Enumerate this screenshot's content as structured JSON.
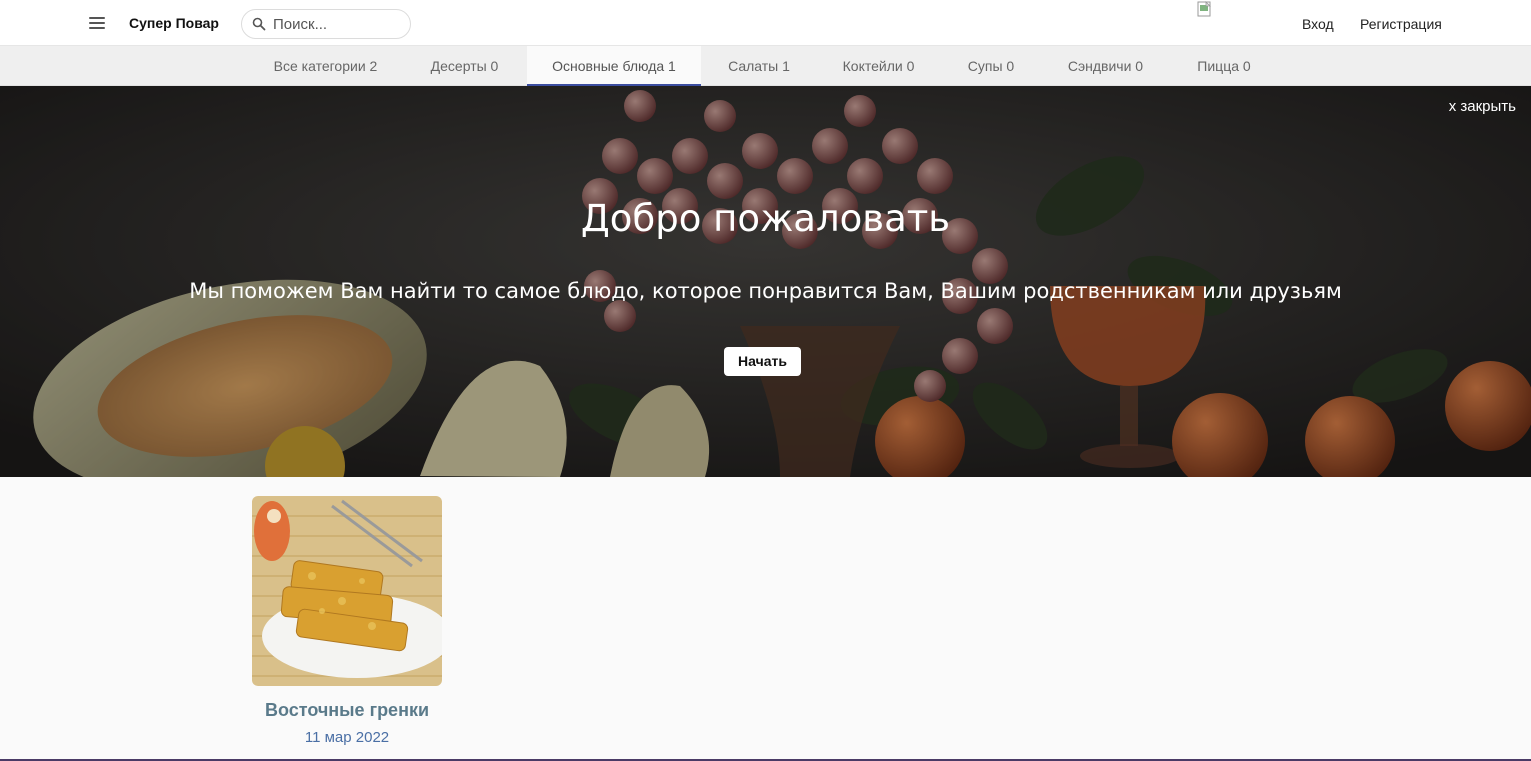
{
  "header": {
    "brand": "Супер Повар",
    "search_placeholder": "Поиск...",
    "login": "Вход",
    "register": "Регистрация"
  },
  "tabs": [
    {
      "label": "Все категории 2",
      "active": false
    },
    {
      "label": "Десерты 0",
      "active": false
    },
    {
      "label": "Основные блюда 1",
      "active": true
    },
    {
      "label": "Салаты 1",
      "active": false
    },
    {
      "label": "Коктейли 0",
      "active": false
    },
    {
      "label": "Супы 0",
      "active": false
    },
    {
      "label": "Сэндвичи 0",
      "active": false
    },
    {
      "label": "Пицца 0",
      "active": false
    }
  ],
  "hero": {
    "close": "x закрыть",
    "title": "Добро пожаловать",
    "subtitle": "Мы поможем Вам найти то самое блюдо, которое понравится Вам, Вашим родственникам или друзьям",
    "button": "Начать"
  },
  "recipes": [
    {
      "title": "Восточные гренки",
      "date": "11 мар 2022"
    }
  ],
  "colors": {
    "accent": "#3c4ea0",
    "card_title": "#5a7a8a",
    "card_date": "#4a6fa5"
  }
}
